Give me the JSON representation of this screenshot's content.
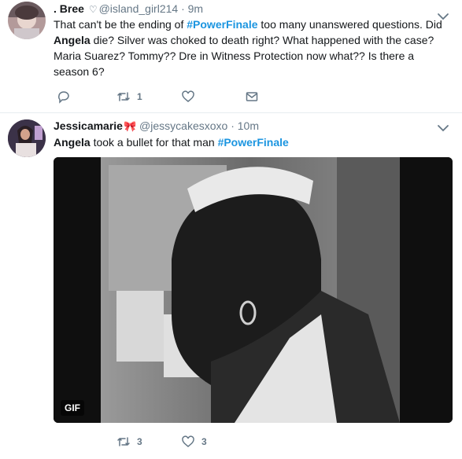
{
  "tweets": [
    {
      "display_name": ". Bree",
      "handle": "@island_girl214",
      "dot": "·",
      "time": "9m",
      "text_parts": [
        "That can't be the ending of ",
        "#PowerFinale",
        " too many unanswered questions. Did ",
        "Angela",
        " die? Silver was choked to death right? What happened with the case? Maria Suarez? Tommy?? Dre in Witness Protection now what?? Is there a season 6?"
      ],
      "reply_count": "",
      "retweet_count": "1",
      "like_count": ""
    },
    {
      "display_name": "Jessicamarie",
      "handle": "@jessycakesxoxo",
      "dot": "·",
      "time": "10m",
      "text_parts": [
        "Angela",
        " took a bullet for that man ",
        "#PowerFinale"
      ],
      "media_badge": "GIF",
      "reply_count": "",
      "retweet_count": "3",
      "like_count": "3"
    }
  ],
  "colors": {
    "accent": "#1b95e0",
    "secondary_text": "#657786",
    "divider": "#e6ecf0"
  },
  "icons": [
    "heart-badge-icon",
    "bow-emoji-icon",
    "chevron-down-icon",
    "reply-icon",
    "retweet-icon",
    "like-icon",
    "dm-icon"
  ]
}
